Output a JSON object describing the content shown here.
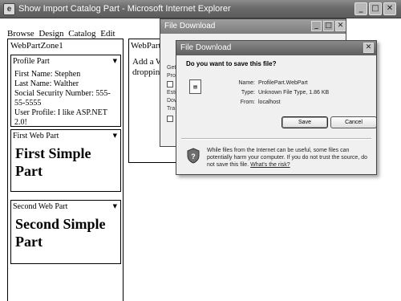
{
  "window": {
    "title": "Show Import Catalog Part - Microsoft Internet Explorer",
    "app_icon": "ie-page-icon",
    "buttons": {
      "minimize": "_",
      "maximize": "□",
      "close": "✕"
    }
  },
  "page": {
    "mode_links": [
      "Browse",
      "Design",
      "Catalog",
      "Edit"
    ],
    "zone1": {
      "title": "WebPartZone1",
      "parts": [
        {
          "title": "Profile Part",
          "menu": "▼",
          "lines": [
            "First Name: Stephen",
            "Last Name: Walther",
            "Social Security Number: 555-55-5555",
            "User Profile: I like ASP.NET 2.0!"
          ]
        },
        {
          "title": "First Web Part",
          "menu": "▼",
          "body": "First Simple Part"
        },
        {
          "title": "Second Web Part",
          "menu": "▼",
          "body": "Second Simple Part"
        }
      ]
    },
    "zone2": {
      "title": "WebPartZone2",
      "text": "Add a Web Part to this zone by dropping it here."
    }
  },
  "dialog_back": {
    "title": "File Download",
    "lines": [
      "Get",
      "Pro",
      "Esti",
      "Dow",
      "Tra"
    ]
  },
  "dialog_front": {
    "title": "File Download",
    "question": "Do you want to save this file?",
    "fields": [
      {
        "label": "Name:",
        "value": "ProfilePart.WebPart"
      },
      {
        "label": "Type:",
        "value": "Unknown File Type, 1.86 KB"
      },
      {
        "label": "From:",
        "value": "localhost"
      }
    ],
    "save_label": "Save",
    "cancel_label": "Cancel",
    "warning": "While files from the Internet can be useful, some files can potentially harm your computer. If you do not trust the source, do not save this file.",
    "warning_link": "What's the risk?"
  }
}
